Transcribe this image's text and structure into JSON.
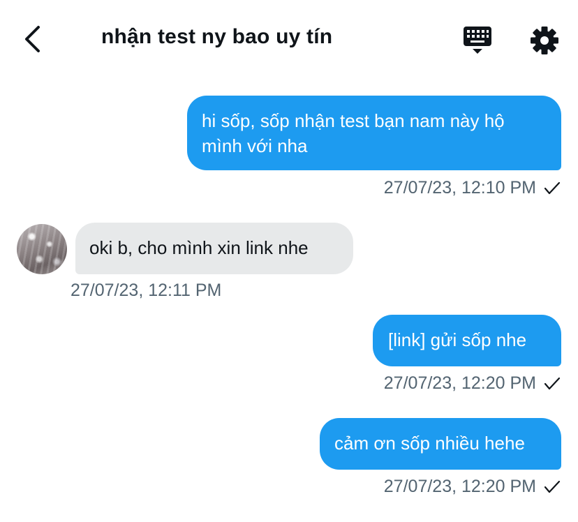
{
  "header": {
    "title": "nhận test ny bao uy tín"
  },
  "icons": {
    "back": "chevron-left-icon",
    "keyboard": "keyboard-icon",
    "settings": "gear-icon",
    "sent": "checkmark-icon"
  },
  "colors": {
    "outgoing_bubble": "#1d9bf0",
    "incoming_bubble": "#e7e9ea",
    "timestamp": "#536471"
  },
  "messages": [
    {
      "direction": "outgoing",
      "text_line1": "hi sốp, sốp nhận test bạn nam này hộ",
      "text_line2": "mình với nha",
      "time": "27/07/23, 12:10 PM"
    },
    {
      "direction": "incoming",
      "text": "oki b, cho mình xin link nhe",
      "time": "27/07/23, 12:11 PM"
    },
    {
      "direction": "outgoing",
      "text": "[link] gửi sốp nhe",
      "time": "27/07/23, 12:20 PM"
    },
    {
      "direction": "outgoing",
      "text": "cảm ơn sốp nhiều hehe",
      "time": "27/07/23, 12:20 PM"
    }
  ]
}
